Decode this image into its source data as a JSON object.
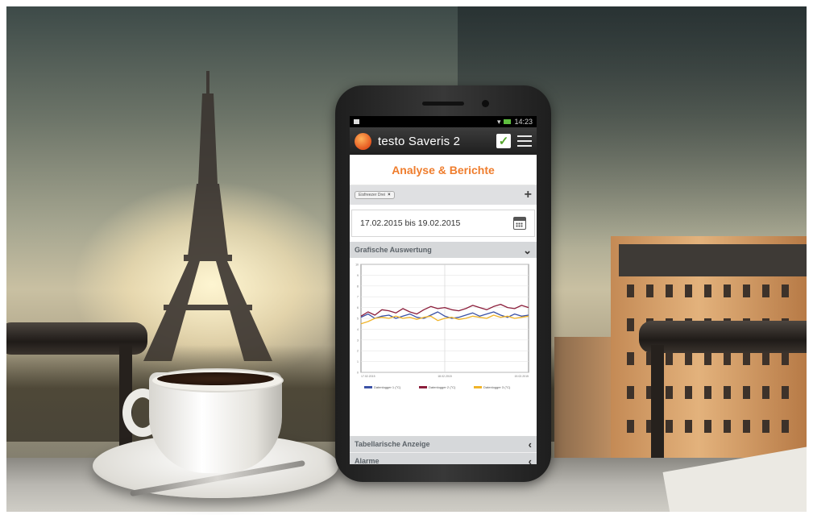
{
  "phone": {
    "status_time": "14:23",
    "app_title": "testo Saveris 2",
    "page_title": "Analyse & Berichte",
    "filter_chip": "Eisfreezer Drei",
    "date_range": "17.02.2015 bis 19.02.2015",
    "sections": {
      "grafische": "Grafische Auswertung",
      "tabellarische": "Tabellarische Anzeige",
      "alarme": "Alarme"
    }
  },
  "chart_data": {
    "type": "line",
    "ylim": [
      0,
      10
    ],
    "x_ticks": [
      "17.02.2015",
      "18.02.2015",
      "19.02.2015"
    ],
    "y_ticks": [
      "0",
      "1",
      "2",
      "3",
      "4",
      "5",
      "6",
      "7",
      "8",
      "9",
      "10"
    ],
    "series": [
      {
        "name": "Datenlogger 1 (°C)",
        "color": "#3b52a6",
        "values": [
          5.1,
          5.4,
          5.0,
          5.2,
          5.3,
          5.0,
          5.2,
          5.4,
          5.1,
          5.0,
          5.3,
          5.6,
          5.2,
          5.0,
          5.1,
          5.3,
          5.5,
          5.2,
          5.4,
          5.6,
          5.3,
          5.1,
          5.4,
          5.2,
          5.3
        ]
      },
      {
        "name": "Datenlogger 2 (°C)",
        "color": "#8c1f3c",
        "values": [
          5.2,
          5.6,
          5.3,
          5.8,
          5.7,
          5.5,
          5.9,
          5.6,
          5.4,
          5.8,
          6.1,
          5.9,
          6.0,
          5.8,
          5.7,
          5.9,
          6.2,
          6.0,
          5.8,
          6.1,
          6.3,
          6.0,
          5.9,
          6.2,
          6.0
        ]
      },
      {
        "name": "Datenlogger 3 (°C)",
        "color": "#f0b429",
        "values": [
          4.5,
          4.7,
          5.0,
          5.1,
          5.0,
          5.2,
          5.0,
          5.1,
          4.9,
          5.1,
          5.2,
          4.8,
          5.0,
          5.1,
          4.9,
          5.0,
          5.2,
          5.1,
          5.0,
          5.3,
          5.1,
          5.2,
          5.0,
          5.1,
          5.2
        ]
      }
    ]
  }
}
